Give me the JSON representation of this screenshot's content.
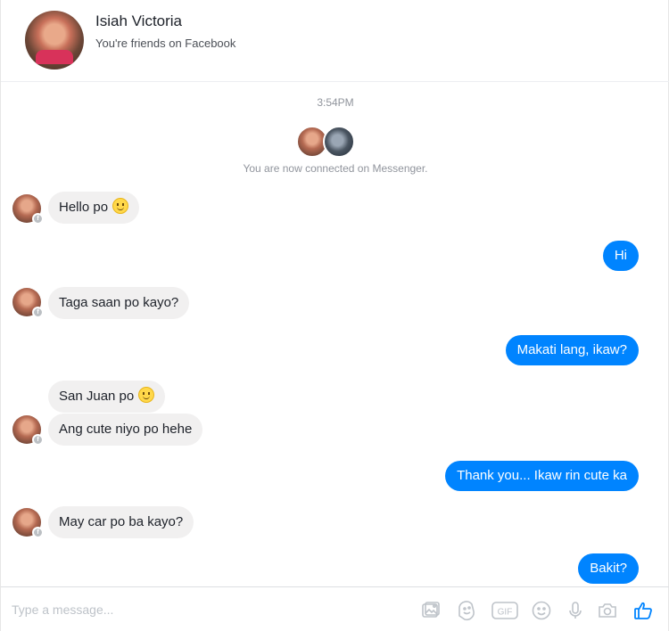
{
  "header": {
    "name": "Isiah Victoria",
    "subtitle": "You're friends on Facebook"
  },
  "thread": {
    "timestamp": "3:54PM",
    "connected_text": "You are now connected on Messenger."
  },
  "messages": [
    {
      "from": "them",
      "text": "Hello po",
      "emoji": "smile"
    },
    {
      "from": "me",
      "text": "Hi"
    },
    {
      "from": "them",
      "text": "Taga saan po kayo?"
    },
    {
      "from": "me",
      "text": "Makati lang, ikaw?"
    },
    {
      "from": "them",
      "text": "San Juan po",
      "emoji": "smile"
    },
    {
      "from": "them",
      "text": "Ang cute niyo po hehe"
    },
    {
      "from": "me",
      "text": "Thank you... Ikaw rin cute ka"
    },
    {
      "from": "them",
      "text": "May car po ba kayo?"
    },
    {
      "from": "me",
      "text": "Bakit?"
    }
  ],
  "composer": {
    "placeholder": "Type a message...",
    "tools": [
      "image-icon",
      "sticker-icon",
      "gif-icon",
      "emoji-icon",
      "microphone-icon",
      "camera-icon",
      "thumbs-up-icon"
    ]
  },
  "colors": {
    "accent": "#0084ff",
    "incoming_bubble": "#f1f0f0",
    "muted_text": "#90949c"
  }
}
